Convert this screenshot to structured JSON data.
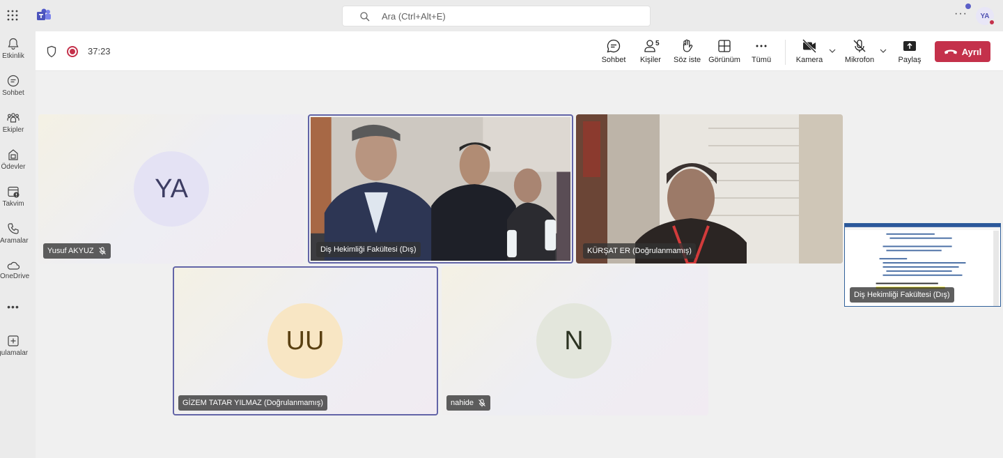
{
  "app": {
    "search_placeholder": "Ara (Ctrl+Alt+E)",
    "user_initials": "YA",
    "colors": {
      "accent": "#5b5fc7",
      "leave": "#c4314b",
      "speaking_border": "#6264a7"
    }
  },
  "rail": {
    "items": [
      {
        "label": "Etkinlik",
        "icon": "bell-icon"
      },
      {
        "label": "Sohbet",
        "icon": "chat-icon"
      },
      {
        "label": "Ekipler",
        "icon": "teams-icon"
      },
      {
        "label": "Ödevler",
        "icon": "assignments-icon"
      },
      {
        "label": "Takvim",
        "icon": "calendar-icon"
      },
      {
        "label": "Aramalar",
        "icon": "phone-icon"
      },
      {
        "label": "OneDrive",
        "icon": "cloud-icon"
      },
      {
        "label": "Uygulamalar",
        "icon": "add-apps-icon"
      }
    ],
    "more": "•••"
  },
  "meeting": {
    "timer": "37:23",
    "toolbar": {
      "chat": "Sohbet",
      "people": "Kişiler",
      "people_count": "5",
      "raise_hand": "Söz iste",
      "view": "Görünüm",
      "more": "Tümü",
      "camera": "Kamera",
      "mic": "Mikrofon",
      "share": "Paylaş",
      "leave": "Ayrıl"
    },
    "tiles": [
      {
        "name": "Yusuf AKYUZ",
        "initials": "YA",
        "muted": true
      },
      {
        "name": "Diş Hekimliği Fakültesi (Dış)",
        "video": true,
        "speaking": true
      },
      {
        "name": "KÜRŞAT ER (Doğrulanmamış)",
        "video": true
      },
      {
        "name": "GİZEM TATAR YILMAZ (Doğrulanmamış)",
        "initials": "UU",
        "speaking": true
      },
      {
        "name": "nahide",
        "initials": "N",
        "muted": true
      }
    ],
    "screen_share": {
      "name": "Diş Hekimliği Fakültesi (Dış)"
    }
  }
}
